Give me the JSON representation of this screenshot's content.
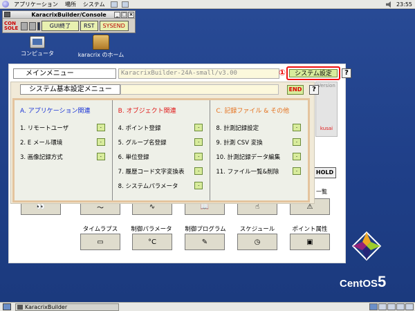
{
  "top_panel": {
    "menus": [
      "アプリケーション",
      "場所",
      "システム"
    ],
    "clock": "23:55"
  },
  "console_window": {
    "title": "KaracrixBuilder/Console",
    "console_label_1": "CON",
    "console_label_2": "SOLE",
    "gui_exit_label": "GUI終了",
    "rst_label": "RST",
    "sysend_label": "SYSEND"
  },
  "desktop_icons": {
    "computer_label": "コンピュータ",
    "home_label": "karacrix のホーム"
  },
  "main_menu": {
    "title": "メインメニュー",
    "version": "KaracrixBuilder-24A-small/v3.00",
    "annotation_number": "①",
    "system_settings_label": "システム設定",
    "help_label": "?",
    "version_text": "Version",
    "kusai_text": "kusai",
    "hold_label": "HOLD",
    "list_label": "一覧",
    "bottom_buttons": [
      {
        "label": "タイムラプス"
      },
      {
        "label": "制御パラメータ"
      },
      {
        "label": "制御プログラム"
      },
      {
        "label": "スケジュール"
      },
      {
        "label": "ポイント属性"
      }
    ]
  },
  "system_dialog": {
    "title": "システム基本設定メニュー",
    "end_label": "END",
    "help_label": "?",
    "panels": [
      {
        "heading": "A. アプリケーション関連",
        "heading_color": "#1a33d6",
        "items": [
          "1. リモートユーザ",
          "2. E メール環境",
          "3. 画像記録方式"
        ]
      },
      {
        "heading": "B. オブジェクト関連",
        "heading_color": "#e01818",
        "items": [
          "4. ポイント登録",
          "5. グループ名登録",
          "6. 単位登録",
          "7. 履歴コード文字変換表",
          "8. システムパラメータ"
        ]
      },
      {
        "heading": "C. 記録ファイル & その他",
        "heading_color": "#e5701c",
        "items": [
          "8. 計測記録設定",
          "9. 計測 CSV 変換",
          "10. 計測記録データ編集",
          "11. ファイル一覧&削除"
        ]
      }
    ],
    "small_button_glyph": "-"
  },
  "branding": {
    "os_name": "CentOS",
    "os_version": "5"
  },
  "taskbar": {
    "task_label": "KaracrixBuilder"
  },
  "colors": {
    "desktop_bg": "#1f3f88",
    "highlight_red": "#f01010",
    "button_green": "#d8ec9c"
  }
}
